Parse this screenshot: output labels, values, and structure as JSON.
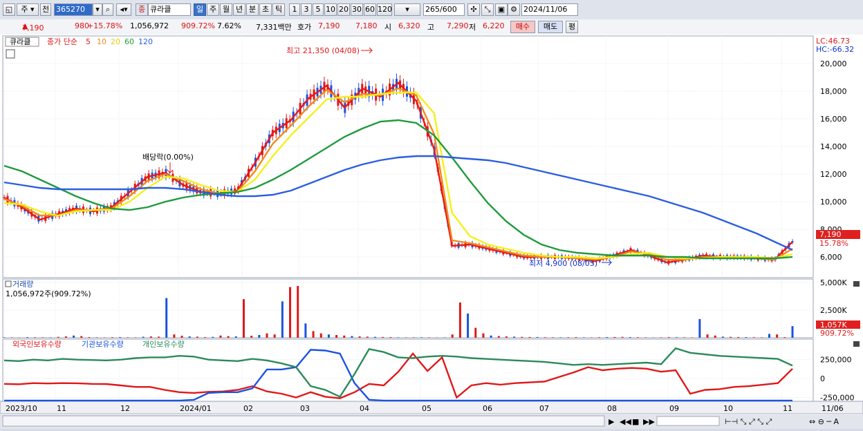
{
  "toolbar": {
    "period_type": "주",
    "prev_label": "전",
    "stock_code": "365270",
    "stock_badge": "종",
    "stock_name": "큐라클",
    "period_buttons": [
      "일",
      "주",
      "월",
      "년",
      "분",
      "초",
      "틱"
    ],
    "interval_buttons": [
      "1",
      "3",
      "5",
      "10",
      "20",
      "30",
      "60",
      "120"
    ],
    "count_value": "265",
    "count_total": "/600",
    "date_value": "2024/11/06"
  },
  "quote_bar": {
    "price": "7,190",
    "change": "980",
    "change_pct": "+15.78%",
    "volume": "1,056,972",
    "volume_ratio": "909.72%",
    "turnover": "7.62%",
    "amount": "7,331백만",
    "bid_label": "호가",
    "ask_price": "7,190",
    "bid_price": "7,180",
    "open_label": "시",
    "open": "6,320",
    "high_label": "고",
    "high": "7,290",
    "low_label": "저",
    "low": "6,220",
    "buy_label": "매수",
    "sell_label": "매도",
    "eval_label": "평"
  },
  "price_panel": {
    "stock_label": "큐라클",
    "ma_title": "종가 단순",
    "ma_periods": [
      "5",
      "10",
      "20",
      "60",
      "120"
    ],
    "lc": "LC:46.73",
    "hc": "HC:-66.32",
    "high_annot": "최고 21,350 (04/08)",
    "low_annot": "최저 4,900 (08/05)",
    "dividend_annot": "배당락(0.00%)",
    "current_price": "7,190",
    "current_pct": "15.78%"
  },
  "volume_panel": {
    "title": "거래량",
    "value": "1,056,972주(909.72%)",
    "current": "1,057K",
    "current_pct": "909.72%"
  },
  "holding_panel": {
    "series": [
      "외국인보유수량",
      "기관보유수량",
      "개인보유수량"
    ]
  },
  "chart_data": [
    {
      "type": "line",
      "title": "큐라클",
      "x": [
        "2023/10",
        "11",
        "12",
        "2024/01",
        "02",
        "03",
        "04",
        "05",
        "06",
        "07",
        "08",
        "09",
        "10",
        "11",
        "11/06"
      ],
      "yticks": [
        "20,000",
        "18,000",
        "16,000",
        "14,000",
        "12,000",
        "10,000",
        "8,000",
        "6,000"
      ],
      "ylim": [
        4500,
        22000
      ],
      "series": [
        {
          "name": "5",
          "color": "#e81818",
          "values": [
            10300,
            9600,
            8700,
            9100,
            9500,
            9300,
            9600,
            10700,
            11800,
            12100,
            11200,
            10700,
            10600,
            10800,
            12800,
            15000,
            15900,
            17500,
            18400,
            16800,
            18200,
            17600,
            18600,
            17300,
            13800,
            6800,
            6900,
            6600,
            6300,
            6000,
            6000,
            6000,
            5900,
            5700,
            6100,
            6500,
            6100,
            5600,
            5800,
            6100,
            6000,
            6000,
            5900,
            5800,
            7100
          ]
        },
        {
          "name": "10",
          "color": "#f08a1a",
          "values": [
            10200,
            9700,
            9000,
            9000,
            9400,
            9400,
            9500,
            10400,
            11500,
            12000,
            11500,
            10900,
            10600,
            10700,
            12200,
            14200,
            15500,
            16900,
            18100,
            17200,
            17800,
            17700,
            18200,
            17700,
            14900,
            7200,
            7000,
            6700,
            6400,
            6100,
            6000,
            6000,
            5900,
            5800,
            6000,
            6400,
            6200,
            5800,
            5800,
            6000,
            6000,
            6000,
            5900,
            5800,
            6600
          ]
        },
        {
          "name": "20",
          "color": "#f5f01a",
          "values": [
            9900,
            9800,
            9300,
            9000,
            9300,
            9400,
            9400,
            10000,
            11000,
            11800,
            11700,
            11200,
            10800,
            10700,
            11600,
            13300,
            14800,
            16100,
            17400,
            17600,
            17600,
            17800,
            17900,
            17900,
            16400,
            9200,
            7500,
            6900,
            6600,
            6300,
            6100,
            6000,
            6000,
            5900,
            6000,
            6200,
            6300,
            6000,
            5900,
            5900,
            6000,
            6000,
            6000,
            5900,
            6200
          ]
        },
        {
          "name": "60",
          "color": "#1e9a3c",
          "values": [
            12600,
            12200,
            11600,
            11000,
            10400,
            9900,
            9500,
            9400,
            9600,
            10000,
            10300,
            10500,
            10600,
            10700,
            11000,
            11600,
            12300,
            13100,
            13900,
            14700,
            15300,
            15800,
            15900,
            15700,
            14800,
            13200,
            11500,
            9900,
            8600,
            7600,
            6900,
            6500,
            6300,
            6200,
            6100,
            6100,
            6100,
            6000,
            6000,
            5900,
            5900,
            5900,
            5900,
            5900,
            6000
          ]
        },
        {
          "name": "120",
          "color": "#2a5ee0",
          "values": [
            11400,
            11200,
            11000,
            10900,
            10900,
            10900,
            10900,
            10900,
            11000,
            11000,
            10900,
            10700,
            10500,
            10400,
            10400,
            10500,
            10800,
            11300,
            11800,
            12300,
            12700,
            13000,
            13200,
            13300,
            13300,
            13200,
            13100,
            13000,
            12800,
            12500,
            12200,
            11900,
            11600,
            11300,
            11000,
            10700,
            10400,
            10000,
            9600,
            9200,
            8700,
            8200,
            7700,
            7100,
            6500
          ]
        }
      ]
    },
    {
      "type": "bar",
      "title": "거래량",
      "yticks": [
        "5,000K",
        "2,500K"
      ],
      "ylim": [
        0,
        5200
      ],
      "values": [
        40,
        35,
        30,
        60,
        45,
        40,
        35,
        80,
        120,
        200,
        150,
        60,
        40,
        30,
        50,
        60,
        40,
        35,
        90,
        120,
        100,
        3600,
        300,
        180,
        120,
        100,
        60,
        80,
        200,
        150,
        120,
        3500,
        180,
        250,
        400,
        300,
        3300,
        4600,
        4700,
        1300,
        600,
        400,
        300,
        250,
        200,
        150,
        120,
        100,
        80,
        70,
        60,
        40,
        35,
        40,
        45,
        40,
        30,
        35,
        300,
        3200,
        2200,
        900,
        400,
        200,
        150,
        120,
        100,
        80,
        70,
        60,
        50,
        45,
        40,
        50,
        60,
        40,
        35,
        50,
        60,
        70,
        80,
        60,
        50,
        40,
        30,
        40,
        60,
        50,
        40,
        35,
        1700,
        300,
        200,
        100,
        80,
        70,
        60,
        50,
        40,
        350,
        300,
        60,
        1057
      ]
    },
    {
      "type": "line",
      "title": "보유수량",
      "yticks": [
        "250,000",
        "0",
        "-250,000"
      ],
      "ylim": [
        -300000,
        420000
      ],
      "series": [
        {
          "name": "외국인보유수량",
          "color": "#e01818",
          "values": [
            -70000,
            -75000,
            -60000,
            -65000,
            -60000,
            -62000,
            -70000,
            -72000,
            -90000,
            -110000,
            -110000,
            -150000,
            -180000,
            -190000,
            -175000,
            -170000,
            -150000,
            -100000,
            -170000,
            -200000,
            -250000,
            -180000,
            -240000,
            -260000,
            -180000,
            -70000,
            -90000,
            90000,
            330000,
            100000,
            280000,
            -250000,
            -90000,
            -60000,
            -80000,
            -60000,
            -50000,
            -40000,
            20000,
            80000,
            150000,
            110000,
            130000,
            140000,
            130000,
            90000,
            110000,
            -200000,
            -150000,
            -140000,
            -110000,
            -100000,
            -80000,
            -60000,
            130000
          ]
        },
        {
          "name": "기관보유수량",
          "color": "#1a52e0",
          "values": [
            -290000,
            -290000,
            -290000,
            -290000,
            -290000,
            -290000,
            -290000,
            -290000,
            -290000,
            -290000,
            -290000,
            -290000,
            -290000,
            -280000,
            -190000,
            -180000,
            -180000,
            -130000,
            120000,
            120000,
            150000,
            380000,
            370000,
            330000,
            -60000,
            -280000,
            -290000,
            -290000,
            -290000,
            -290000,
            -290000,
            -290000,
            -290000,
            -290000,
            -290000,
            -290000,
            -290000,
            -290000,
            -290000,
            -290000,
            -290000,
            -290000,
            -290000,
            -290000,
            -290000,
            -290000,
            -290000,
            -290000,
            -290000,
            -290000,
            -290000,
            -290000,
            -290000,
            -290000,
            -290000
          ]
        },
        {
          "name": "개인보유수량",
          "color": "#2a8a5a",
          "values": [
            240000,
            230000,
            250000,
            240000,
            260000,
            250000,
            245000,
            240000,
            250000,
            270000,
            280000,
            280000,
            300000,
            290000,
            250000,
            240000,
            230000,
            260000,
            240000,
            200000,
            150000,
            -100000,
            -150000,
            -240000,
            60000,
            390000,
            350000,
            280000,
            270000,
            290000,
            300000,
            290000,
            270000,
            260000,
            250000,
            240000,
            230000,
            220000,
            200000,
            180000,
            190000,
            180000,
            190000,
            200000,
            210000,
            190000,
            400000,
            340000,
            320000,
            300000,
            290000,
            280000,
            270000,
            260000,
            170000
          ]
        }
      ]
    }
  ]
}
